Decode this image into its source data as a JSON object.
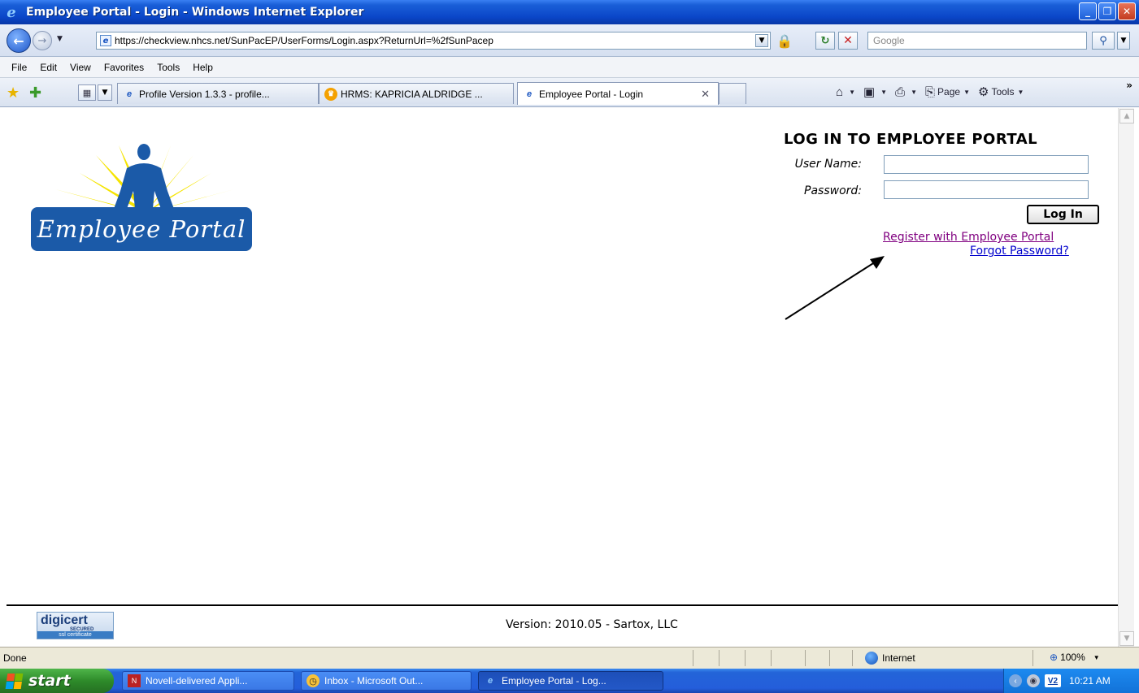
{
  "window": {
    "title": "Employee Portal - Login - Windows Internet Explorer"
  },
  "address_bar": {
    "url": "https://checkview.nhcs.net/SunPacEP/UserForms/Login.aspx?ReturnUrl=%2fSunPacep",
    "search_placeholder": "Google"
  },
  "menu": {
    "items": [
      "File",
      "Edit",
      "View",
      "Favorites",
      "Tools",
      "Help"
    ]
  },
  "tabs": [
    {
      "label": "Profile Version 1.3.3 - profile...",
      "active": false
    },
    {
      "label": "HRMS: KAPRICIA ALDRIDGE ...",
      "active": false
    },
    {
      "label": "Employee Portal - Login",
      "active": true
    }
  ],
  "command_bar": {
    "page_label": "Page",
    "tools_label": "Tools"
  },
  "page": {
    "logo_text": "Employee Portal",
    "login_title": "LOG IN TO EMPLOYEE PORTAL",
    "username_label": "User Name:",
    "password_label": "Password:",
    "username_value": "",
    "password_value": "",
    "login_button": "Log In",
    "register_link": "Register with Employee Portal",
    "forgot_link": "Forgot Password?",
    "digicert_brand": "digicert",
    "digicert_secured": "SECURED",
    "digicert_caption": "ssl certificate",
    "version": "Version: 2010.05 - Sartox, LLC"
  },
  "status_bar": {
    "status": "Done",
    "zone": "Internet",
    "zoom": "100%"
  },
  "taskbar": {
    "start_label": "start",
    "buttons": [
      {
        "label": "Novell-delivered Appli...",
        "active": false
      },
      {
        "label": "Inbox - Microsoft Out...",
        "active": false
      },
      {
        "label": "Employee Portal - Log...",
        "active": true
      }
    ],
    "tray_badge": "V2",
    "clock": "10:21 AM"
  },
  "colors": {
    "logo_plate": "#1b5aa8",
    "visited_link": "#800080",
    "link": "#0000cc"
  }
}
